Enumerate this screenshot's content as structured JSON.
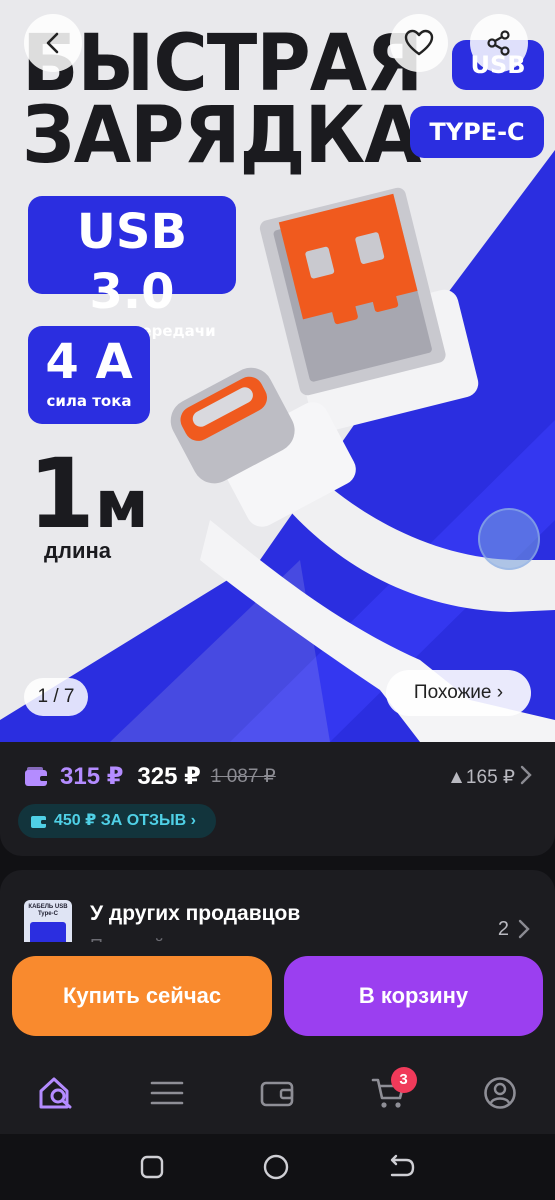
{
  "gallery": {
    "headline_line1": "БЫСТРАЯ",
    "headline_line2": "ЗАРЯДКА",
    "tag_usb": "USB",
    "tag_typec": "TYPE-C",
    "spec1_big": "USB 3.0",
    "spec1_small": "скорость передачи",
    "spec2_big": "4 A",
    "spec2_small": "сила тока",
    "length_value": "1",
    "length_unit": "м",
    "length_label": "длина",
    "counter": "1 / 7",
    "similar_label": "Похожие ›",
    "colors": {
      "accent_blue": "#2b2ee0",
      "connector_orange": "#f05a1e"
    }
  },
  "price": {
    "wallet_price": "315 ₽",
    "main_price": "325 ₽",
    "old_price": "1 087 ₽",
    "rise": "▲165 ₽",
    "review_bonus": "450 ₽ ЗА ОТЗЫВ ›",
    "colors": {
      "wallet": "#b48cff",
      "review_text": "#4fd0e6"
    }
  },
  "sellers": {
    "title": "У других продавцов",
    "subtitle": "По такой же цене или дешевле",
    "count": "2",
    "thumb_text": "КАБЕЛЬ USB Type-C"
  },
  "actions": {
    "buy_now": "Купить сейчас",
    "add_to_cart": "В корзину",
    "colors": {
      "buy": "#f98a2e",
      "cart": "#9b3ff0"
    }
  },
  "nav": {
    "items": [
      {
        "icon": "home-search-icon",
        "active": true
      },
      {
        "icon": "catalog-menu-icon",
        "active": false
      },
      {
        "icon": "wallet-icon",
        "active": false
      },
      {
        "icon": "cart-icon",
        "active": false,
        "badge": "3"
      },
      {
        "icon": "profile-icon",
        "active": false
      }
    ],
    "cart_badge": "3"
  },
  "system_nav": [
    "recent-apps-icon",
    "home-icon",
    "back-icon"
  ]
}
